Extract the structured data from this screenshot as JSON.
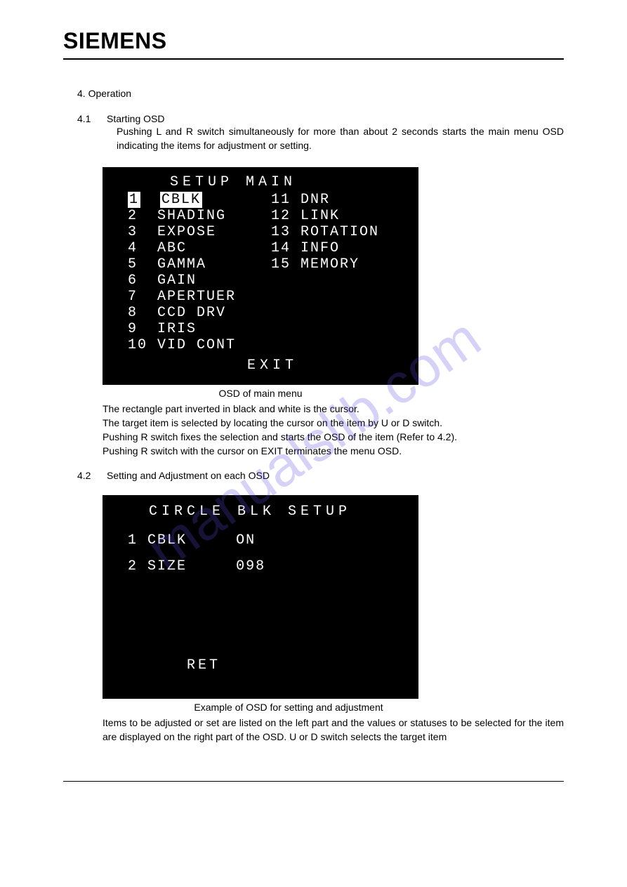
{
  "brand": "SIEMENS",
  "watermark": "manualslib.com",
  "section": {
    "num": "4.",
    "title": "Operation"
  },
  "sub1": {
    "num": "4.1",
    "title": "Starting OSD",
    "para": "Pushing L and R switch simultaneously for more than about 2 seconds starts the main menu OSD indicating the items for adjustment or setting."
  },
  "osd_main": {
    "title": "SETUP   MAIN",
    "left": [
      {
        "num": "1",
        "label": "CBLK",
        "selected": true
      },
      {
        "num": "2",
        "label": "SHADING"
      },
      {
        "num": "3",
        "label": "EXPOSE"
      },
      {
        "num": "4",
        "label": "ABC"
      },
      {
        "num": "5",
        "label": "GAMMA"
      },
      {
        "num": "6",
        "label": "GAIN"
      },
      {
        "num": "7",
        "label": "APERTUER"
      },
      {
        "num": "8",
        "label": "CCD DRV"
      },
      {
        "num": "9",
        "label": "IRIS"
      },
      {
        "num": "10",
        "label": "VID CONT"
      }
    ],
    "right": [
      {
        "num": "11",
        "label": "DNR"
      },
      {
        "num": "12",
        "label": "LINK"
      },
      {
        "num": "13",
        "label": "ROTATION"
      },
      {
        "num": "14",
        "label": "INFO"
      },
      {
        "num": "15",
        "label": "MEMORY"
      }
    ],
    "exit": "EXIT"
  },
  "caption1": "OSD of main menu",
  "post1": {
    "l1": "The rectangle part inverted in black and white is the cursor.",
    "l2": "The target item is selected by locating the cursor on the item by U or D switch.",
    "l3": "Pushing R switch fixes the selection and starts the OSD of the item (Refer to 4.2).",
    "l4": "Pushing R switch with the cursor on EXIT terminates the menu OSD."
  },
  "sub2": {
    "num": "4.2",
    "title": "Setting and Adjustment on each OSD"
  },
  "osd_detail": {
    "title": "CIRCLE BLK SETUP",
    "rows": [
      {
        "num": "1",
        "label": "CBLK",
        "value": "ON",
        "sel": true
      },
      {
        "num": "2",
        "label": "SIZE",
        "value": "098"
      }
    ],
    "ret": "RET"
  },
  "caption2": "Example of OSD for setting and adjustment",
  "post2": "Items to be adjusted or set are listed on the left part and the values or statuses to be selected for the item are displayed on the right part of the OSD. U or D switch selects the target  item"
}
